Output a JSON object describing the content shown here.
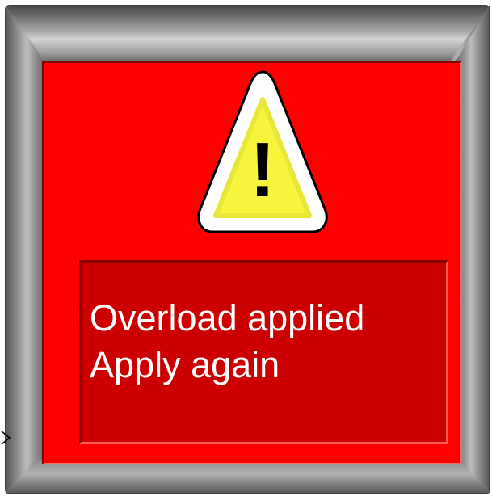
{
  "alarm": {
    "message_line_1": "Overload applied",
    "message_line_2": "Apply again",
    "icon": "warning-triangle-icon",
    "symbol": "!"
  },
  "colors": {
    "panel_background": "#ff0000",
    "message_background": "#cc0000",
    "warning_fill": "#f7f43c",
    "warning_outline": "#ffffff",
    "text": "#ffffff",
    "frame": "#8a8a8a"
  },
  "edge_marker_icon": "chevron-right-icon"
}
